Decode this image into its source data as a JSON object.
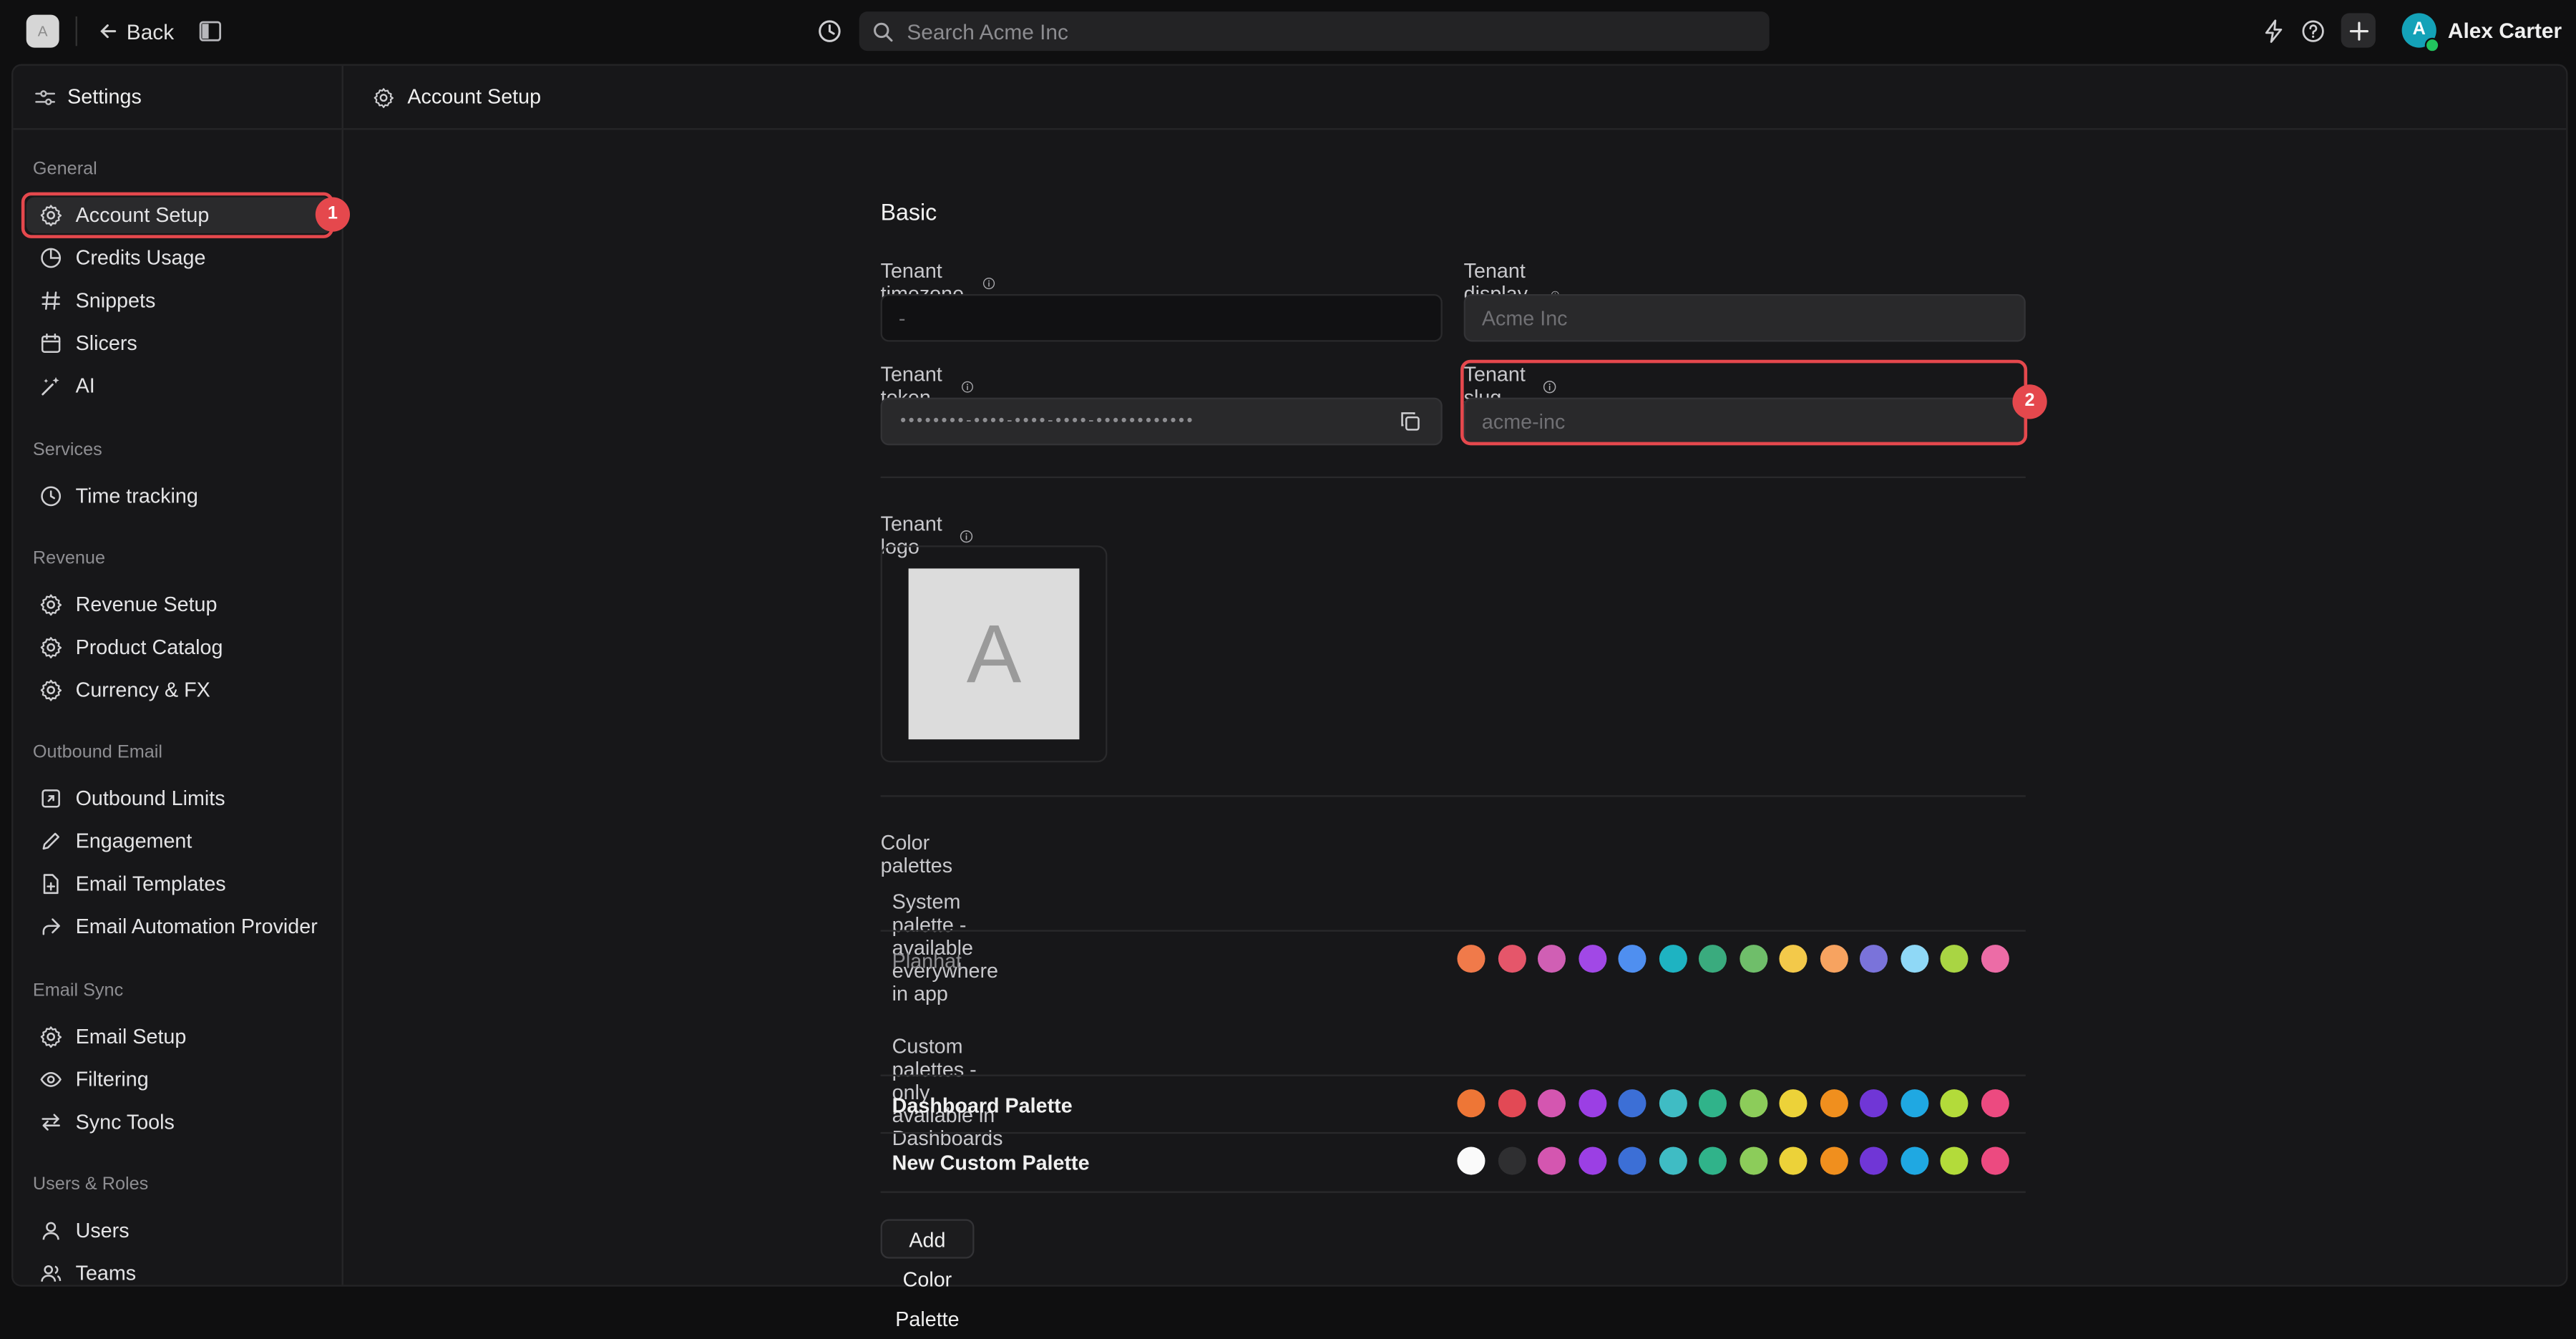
{
  "topbar": {
    "logo_letter": "A",
    "back_label": "Back",
    "search_placeholder": "Search Acme Inc",
    "user_avatar_letter": "A",
    "user_name": "Alex Carter"
  },
  "sidebar": {
    "title": "Settings",
    "groups": [
      {
        "label": "General",
        "items": [
          "Account Setup",
          "Credits Usage",
          "Snippets",
          "Slicers",
          "AI"
        ]
      },
      {
        "label": "Services",
        "items": [
          "Time tracking"
        ]
      },
      {
        "label": "Revenue",
        "items": [
          "Revenue Setup",
          "Product Catalog",
          "Currency & FX"
        ]
      },
      {
        "label": "Outbound Email",
        "items": [
          "Outbound Limits",
          "Engagement",
          "Email Templates",
          "Email Automation Provider"
        ]
      },
      {
        "label": "Email Sync",
        "items": [
          "Email Setup",
          "Filtering",
          "Sync Tools"
        ]
      },
      {
        "label": "Users & Roles",
        "items": [
          "Users",
          "Teams"
        ]
      }
    ],
    "active_item": "Account Setup"
  },
  "header": {
    "title": "Account Setup"
  },
  "basic": {
    "title": "Basic",
    "timezone_label": "Tenant timezone",
    "timezone_value": "-",
    "display_name_label": "Tenant display name",
    "display_name_placeholder": "Acme Inc",
    "token_label": "Tenant token",
    "token_value": "••••••••-••••-••••-••••-••••••••••••",
    "slug_label": "Tenant slug",
    "slug_placeholder": "acme-inc",
    "logo_label": "Tenant logo",
    "logo_letter": "A"
  },
  "palettes": {
    "title": "Color palettes",
    "system_heading": "System palette - available everywhere in app",
    "custom_heading": "Custom palettes - only available in Dashboards",
    "rows": [
      {
        "name": "Planhat",
        "colors": [
          "#f07a4a",
          "#e5566a",
          "#d05fb4",
          "#a148e6",
          "#4f8ff0",
          "#1eb3c2",
          "#3aab7e",
          "#6fbe6a",
          "#f3c94a",
          "#f7a360",
          "#7a73da",
          "#8fd8f6",
          "#a9d543",
          "#ec6ca6"
        ]
      },
      {
        "name": "Dashboard Palette",
        "colors": [
          "#ee7636",
          "#e24955",
          "#d456b0",
          "#9b3fe4",
          "#3c6fd6",
          "#3fbcc4",
          "#30b38a",
          "#8ccc5a",
          "#ecd239",
          "#f08f1e",
          "#7036d6",
          "#1fa8e2",
          "#b3db3a",
          "#ec4a80"
        ]
      },
      {
        "name": "New Custom Palette",
        "colors": [
          "#fafafa",
          "#2f2f31",
          "#d456b0",
          "#9b3fe4",
          "#3c6fd6",
          "#3fbcc4",
          "#30b38a",
          "#8ccc5a",
          "#ecd239",
          "#f08f1e",
          "#7036d6",
          "#1fa8e2",
          "#b3db3a",
          "#ec4a80"
        ]
      }
    ],
    "add_button": "Add Color Palette"
  },
  "annotations": {
    "badge_1": "1",
    "badge_2": "2",
    "color": "#e5484d"
  }
}
